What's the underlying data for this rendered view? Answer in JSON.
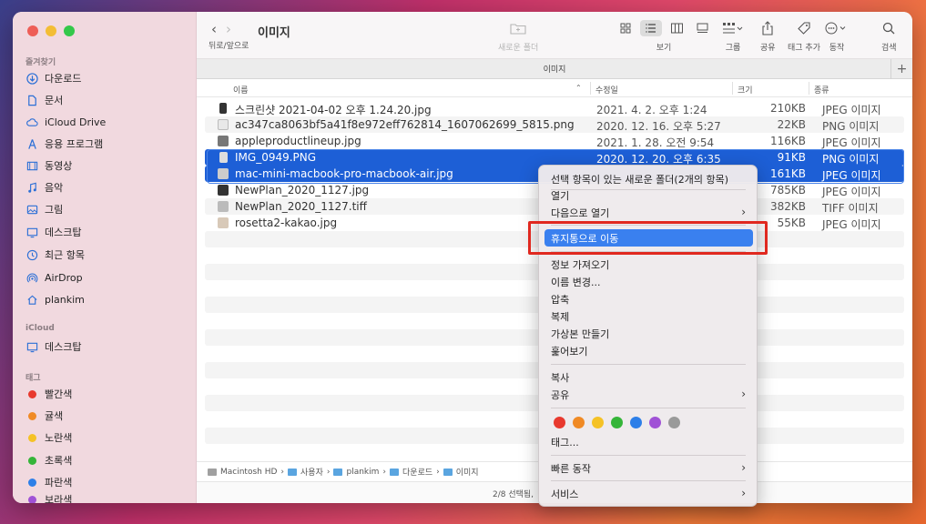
{
  "window": {
    "title": "이미지"
  },
  "sidebar": {
    "favorites_label": "즐겨찾기",
    "favorites": [
      {
        "label": "다운로드",
        "icon": "download-icon"
      },
      {
        "label": "문서",
        "icon": "document-icon"
      },
      {
        "label": "iCloud Drive",
        "icon": "cloud-icon"
      },
      {
        "label": "응용 프로그램",
        "icon": "applications-icon"
      },
      {
        "label": "동영상",
        "icon": "movies-icon"
      },
      {
        "label": "음악",
        "icon": "music-icon"
      },
      {
        "label": "그림",
        "icon": "pictures-icon"
      },
      {
        "label": "데스크탑",
        "icon": "desktop-icon"
      },
      {
        "label": "최근 항목",
        "icon": "clock-icon"
      },
      {
        "label": "AirDrop",
        "icon": "airdrop-icon"
      },
      {
        "label": "plankim",
        "icon": "home-icon"
      }
    ],
    "icloud_label": "iCloud",
    "icloud": [
      {
        "label": "데스크탑",
        "icon": "desktop-icon"
      }
    ],
    "tags_label": "태그",
    "tags": [
      {
        "label": "빨간색",
        "color": "#e8392e"
      },
      {
        "label": "귤색",
        "color": "#f08a25"
      },
      {
        "label": "노란색",
        "color": "#f5c226"
      },
      {
        "label": "초록색",
        "color": "#35b539"
      },
      {
        "label": "파란색",
        "color": "#2d7fe8"
      },
      {
        "label": "보라색",
        "color": "#a052d6"
      }
    ]
  },
  "toolbar": {
    "nav_label": "뒤로/앞으로",
    "new_folder_label": "새로운 폴더",
    "view_label": "보기",
    "group_label": "그룹",
    "share_label": "공유",
    "tag_add_label": "태그 추가",
    "action_label": "동작",
    "search_label": "검색"
  },
  "tabbar": {
    "title": "이미지"
  },
  "columns": {
    "name": "이름",
    "date": "수정일",
    "size": "크기",
    "kind": "종류"
  },
  "files": [
    {
      "name": "스크린샷 2021-04-02 오후 1.24.20.jpg",
      "date": "2021. 4. 2. 오후 1:24",
      "size": "210KB",
      "kind": "JPEG 이미지",
      "selected": false
    },
    {
      "name": "ac347ca8063bf5a41f8e972eff762814_1607062699_5815.png",
      "date": "2020. 12. 16. 오후 5:27",
      "size": "22KB",
      "kind": "PNG 이미지",
      "selected": false
    },
    {
      "name": "appleproductlineup.jpg",
      "date": "2021. 1. 28. 오전 9:54",
      "size": "116KB",
      "kind": "JPEG 이미지",
      "selected": false
    },
    {
      "name": "IMG_0949.PNG",
      "date": "2020. 12. 20. 오후 6:35",
      "size": "91KB",
      "kind": "PNG 이미지",
      "selected": true
    },
    {
      "name": "mac-mini-macbook-pro-macbook-air.jpg",
      "date": "",
      "size": "161KB",
      "kind": "JPEG 이미지",
      "selected": true
    },
    {
      "name": "NewPlan_2020_1127.jpg",
      "date": "",
      "size": "785KB",
      "kind": "JPEG 이미지",
      "selected": false
    },
    {
      "name": "NewPlan_2020_1127.tiff",
      "date": "",
      "size": "382KB",
      "kind": "TIFF 이미지",
      "selected": false
    },
    {
      "name": "rosetta2-kakao.jpg",
      "date": "",
      "size": "55KB",
      "kind": "JPEG 이미지",
      "selected": false
    }
  ],
  "pathbar": [
    "Macintosh HD",
    "사용자",
    "plankim",
    "다운로드",
    "이미지"
  ],
  "status": {
    "text": "2/8 선택됨,"
  },
  "context_menu": {
    "new_folder": "선택 항목이 있는 새로운 폴더(2개의 항목)",
    "open": "열기",
    "open_with": "다음으로 열기",
    "move_to_trash": "휴지통으로 이동",
    "get_info": "정보 가져오기",
    "rename": "이름 변경...",
    "compress": "압축",
    "duplicate": "복제",
    "make_alias": "가상본 만들기",
    "quick_look": "훑어보기",
    "copy": "복사",
    "share": "공유",
    "tag_colors": [
      "#e8392e",
      "#f08a25",
      "#f5c226",
      "#35b539",
      "#2d7fe8",
      "#a052d6",
      "#9a9a9a"
    ],
    "tags": "태그...",
    "quick_actions": "빠른 동작",
    "services": "서비스"
  }
}
